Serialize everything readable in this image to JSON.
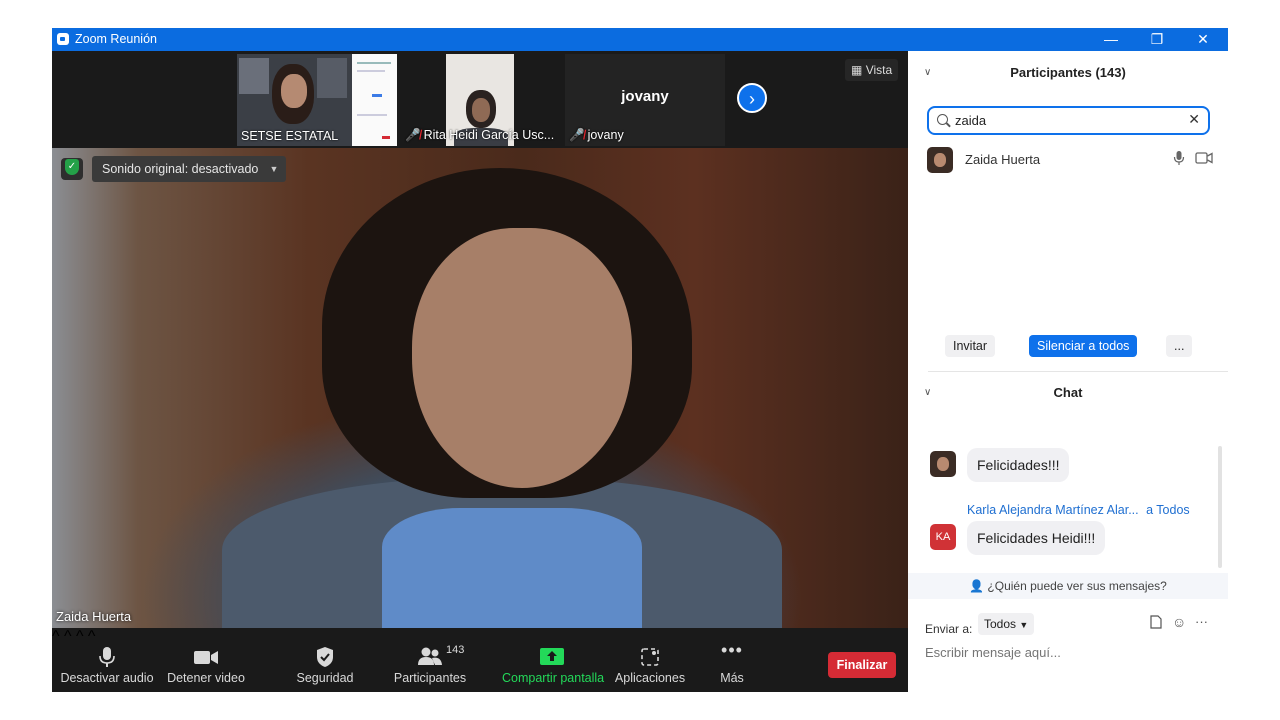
{
  "window": {
    "title": "Zoom Reunión",
    "minimize": "—",
    "restore": "❐",
    "close": "✕"
  },
  "thumbnails": [
    {
      "name": "SETSE ESTATAL",
      "muted": false
    },
    {
      "name": "Rita Heidi García Usc...",
      "muted": true
    },
    {
      "name": "jovany",
      "muted": true,
      "center_label": "jovany"
    }
  ],
  "view_button": "Vista",
  "original_sound": "Sonido original: desactivado",
  "active_speaker": "Zaida Huerta",
  "toolbar": {
    "mute": "Desactivar audio",
    "video": "Detener video",
    "security": "Seguridad",
    "participants": "Participantes",
    "participants_count": "143",
    "share": "Compartir pantalla",
    "apps": "Aplicaciones",
    "more": "Más",
    "end": "Finalizar"
  },
  "participants_panel": {
    "header": "Participantes (143)",
    "search_value": "zaida",
    "results": [
      {
        "name": "Zaida Huerta"
      }
    ],
    "invite": "Invitar",
    "mute_all": "Silenciar a todos",
    "more": "..."
  },
  "chat": {
    "header": "Chat",
    "messages": [
      {
        "text": "Felicidades!!!"
      },
      {
        "sender": "Karla Alejandra Martínez Alar...",
        "to": "a Todos",
        "avatar_initials": "KA",
        "text": "Felicidades Heidi!!!"
      }
    ],
    "who_can_see": "¿Quién puede ver sus mensajes?",
    "send_to_label": "Enviar a:",
    "send_to_value": "Todos",
    "compose_placeholder": "Escribir mensaje aquí..."
  },
  "colors": {
    "zoom_blue": "#0b6ce0",
    "end_red": "#d52b35",
    "share_green": "#23d959"
  }
}
